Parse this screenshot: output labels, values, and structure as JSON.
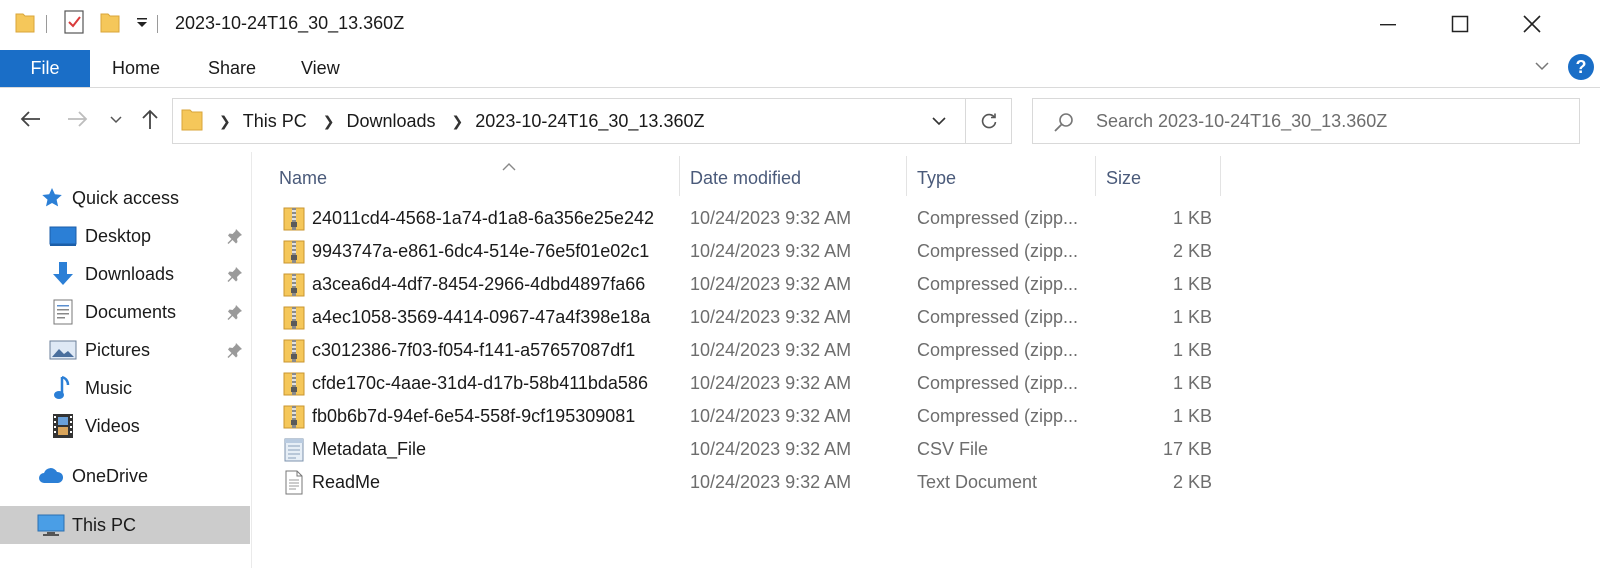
{
  "window": {
    "title": "2023-10-24T16_30_13.360Z",
    "minimize_icon": "minimize-icon",
    "maximize_icon": "maximize-icon",
    "close_icon": "close-icon"
  },
  "ribbon": {
    "tabs": [
      {
        "label": "File",
        "active": true
      },
      {
        "label": "Home"
      },
      {
        "label": "Share"
      },
      {
        "label": "View"
      }
    ],
    "help_label": "?"
  },
  "address": {
    "crumbs": [
      "This PC",
      "Downloads",
      "2023-10-24T16_30_13.360Z"
    ]
  },
  "search": {
    "placeholder": "Search 2023-10-24T16_30_13.360Z"
  },
  "sidebar": {
    "items": [
      {
        "label": "Quick access",
        "icon": "star-icon"
      },
      {
        "label": "Desktop",
        "icon": "desktop-icon",
        "pinned": true
      },
      {
        "label": "Downloads",
        "icon": "download-arrow-icon",
        "pinned": true
      },
      {
        "label": "Documents",
        "icon": "documents-icon",
        "pinned": true
      },
      {
        "label": "Pictures",
        "icon": "pictures-icon",
        "pinned": true
      },
      {
        "label": "Music",
        "icon": "music-note-icon"
      },
      {
        "label": "Videos",
        "icon": "film-icon"
      },
      {
        "label": "OneDrive",
        "icon": "cloud-icon"
      },
      {
        "label": "This PC",
        "icon": "computer-icon",
        "selected": true
      }
    ]
  },
  "columns": {
    "name": "Name",
    "date": "Date modified",
    "type": "Type",
    "size": "Size"
  },
  "files": [
    {
      "name": "24011cd4-4568-1a74-d1a8-6a356e25e242",
      "date": "10/24/2023 9:32 AM",
      "type": "Compressed (zipp...",
      "size": "1 KB",
      "icon": "zip-folder-icon"
    },
    {
      "name": "9943747a-e861-6dc4-514e-76e5f01e02c1",
      "date": "10/24/2023 9:32 AM",
      "type": "Compressed (zipp...",
      "size": "2 KB",
      "icon": "zip-folder-icon"
    },
    {
      "name": "a3cea6d4-4df7-8454-2966-4dbd4897fa66",
      "date": "10/24/2023 9:32 AM",
      "type": "Compressed (zipp...",
      "size": "1 KB",
      "icon": "zip-folder-icon"
    },
    {
      "name": "a4ec1058-3569-4414-0967-47a4f398e18a",
      "date": "10/24/2023 9:32 AM",
      "type": "Compressed (zipp...",
      "size": "1 KB",
      "icon": "zip-folder-icon"
    },
    {
      "name": "c3012386-7f03-f054-f141-a57657087df1",
      "date": "10/24/2023 9:32 AM",
      "type": "Compressed (zipp...",
      "size": "1 KB",
      "icon": "zip-folder-icon"
    },
    {
      "name": "cfde170c-4aae-31d4-d17b-58b411bda586",
      "date": "10/24/2023 9:32 AM",
      "type": "Compressed (zipp...",
      "size": "1 KB",
      "icon": "zip-folder-icon"
    },
    {
      "name": "fb0b6b7d-94ef-6e54-558f-9cf195309081",
      "date": "10/24/2023 9:32 AM",
      "type": "Compressed (zipp...",
      "size": "1 KB",
      "icon": "zip-folder-icon"
    },
    {
      "name": "Metadata_File",
      "date": "10/24/2023 9:32 AM",
      "type": "CSV File",
      "size": "17 KB",
      "icon": "csv-file-icon"
    },
    {
      "name": "ReadMe",
      "date": "10/24/2023 9:32 AM",
      "type": "Text Document",
      "size": "2 KB",
      "icon": "text-file-icon"
    }
  ],
  "colors": {
    "accent": "#1a6ec7",
    "folder": "#f5c75a",
    "selected_bg": "#cccccc"
  }
}
